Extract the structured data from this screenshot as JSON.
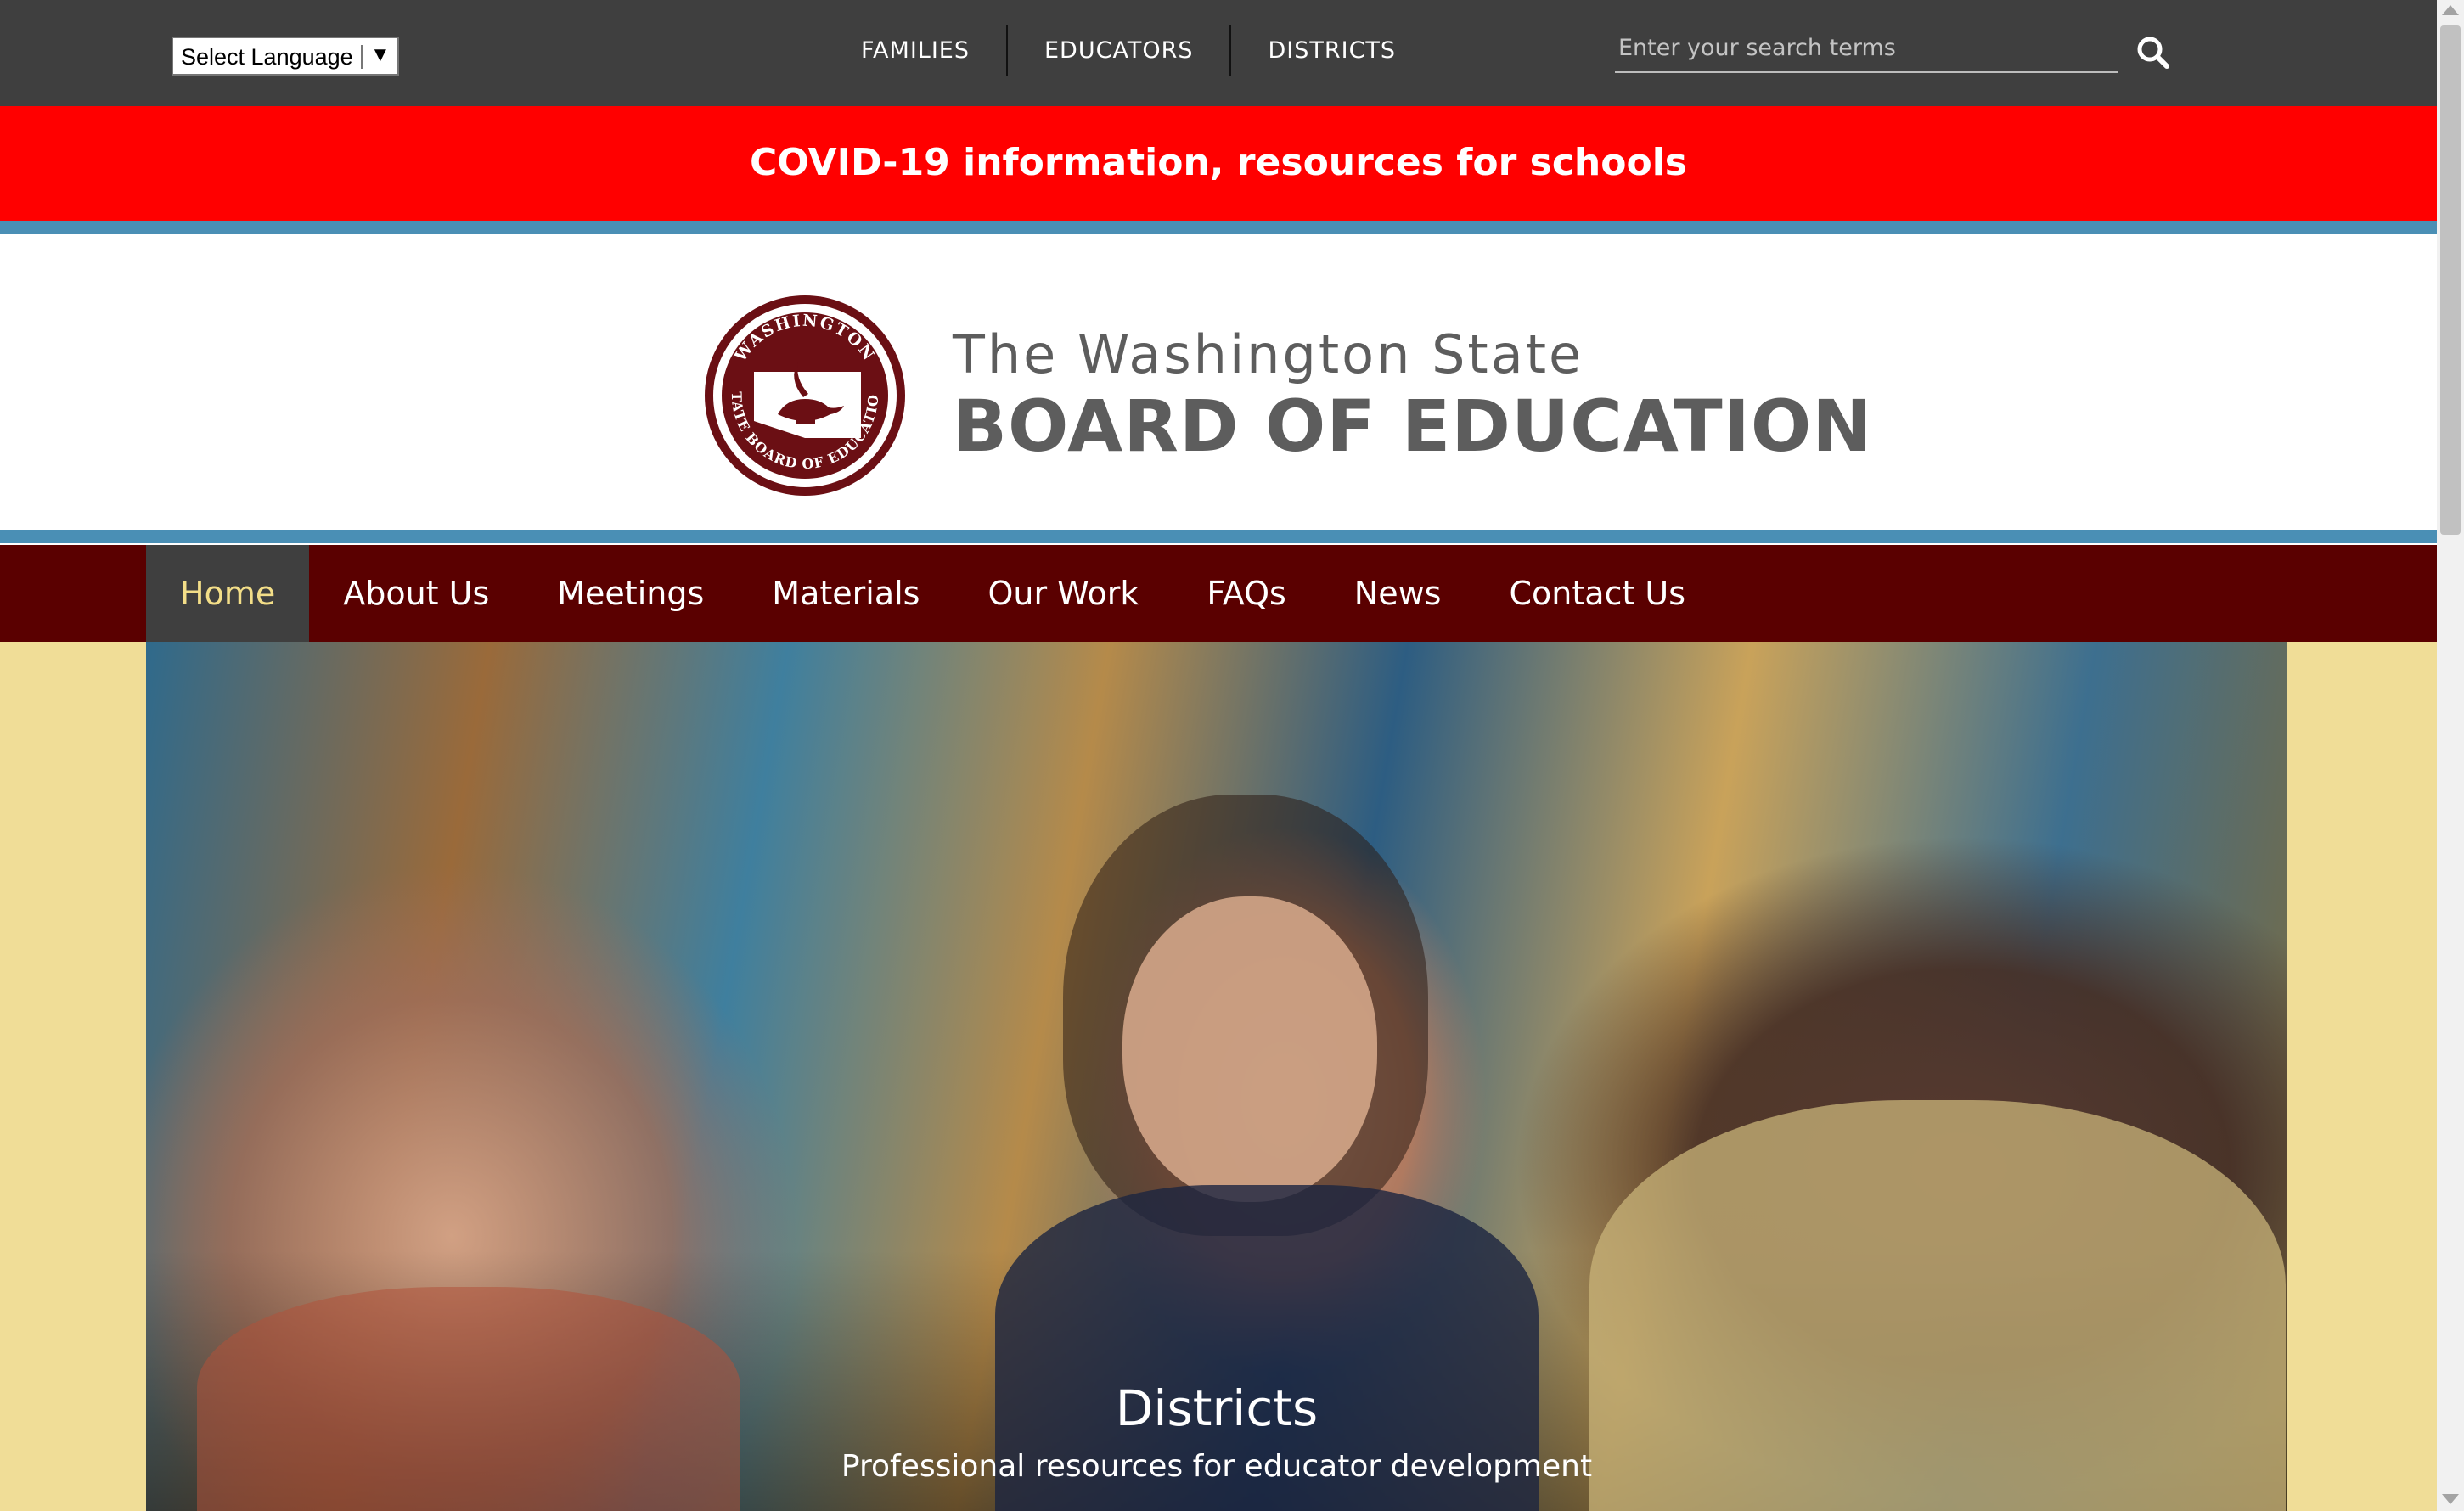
{
  "topbar": {
    "language_select": {
      "label": "Select Language",
      "arrow": "▼"
    },
    "audience_nav": [
      {
        "label": "FAMILIES"
      },
      {
        "label": "EDUCATORS"
      },
      {
        "label": "DISTRICTS"
      }
    ],
    "search": {
      "placeholder": "Enter your search terms",
      "icon": "search-icon"
    }
  },
  "alert_banner": {
    "text": "COVID-19 information, resources for schools",
    "background": "#ff0000"
  },
  "header": {
    "seal": {
      "top_text": "WASHINGTON",
      "bottom_text": "STATE BOARD OF EDUCATION",
      "color": "#6b0f14"
    },
    "title_line1": "The Washington State",
    "title_line2": "BOARD OF EDUCATION"
  },
  "main_nav": [
    {
      "label": "Home",
      "active": true
    },
    {
      "label": "About Us"
    },
    {
      "label": "Meetings"
    },
    {
      "label": "Materials"
    },
    {
      "label": "Our Work"
    },
    {
      "label": "FAQs"
    },
    {
      "label": "News"
    },
    {
      "label": "Contact Us"
    }
  ],
  "hero": {
    "title": "Districts",
    "subtitle": "Professional resources for educator development"
  },
  "colors": {
    "topbar": "#3f3f3f",
    "stripe": "#4a8fb5",
    "nav": "#5a0000",
    "nav_active_text": "#f3de88",
    "hero_side": "#f0dd97"
  }
}
